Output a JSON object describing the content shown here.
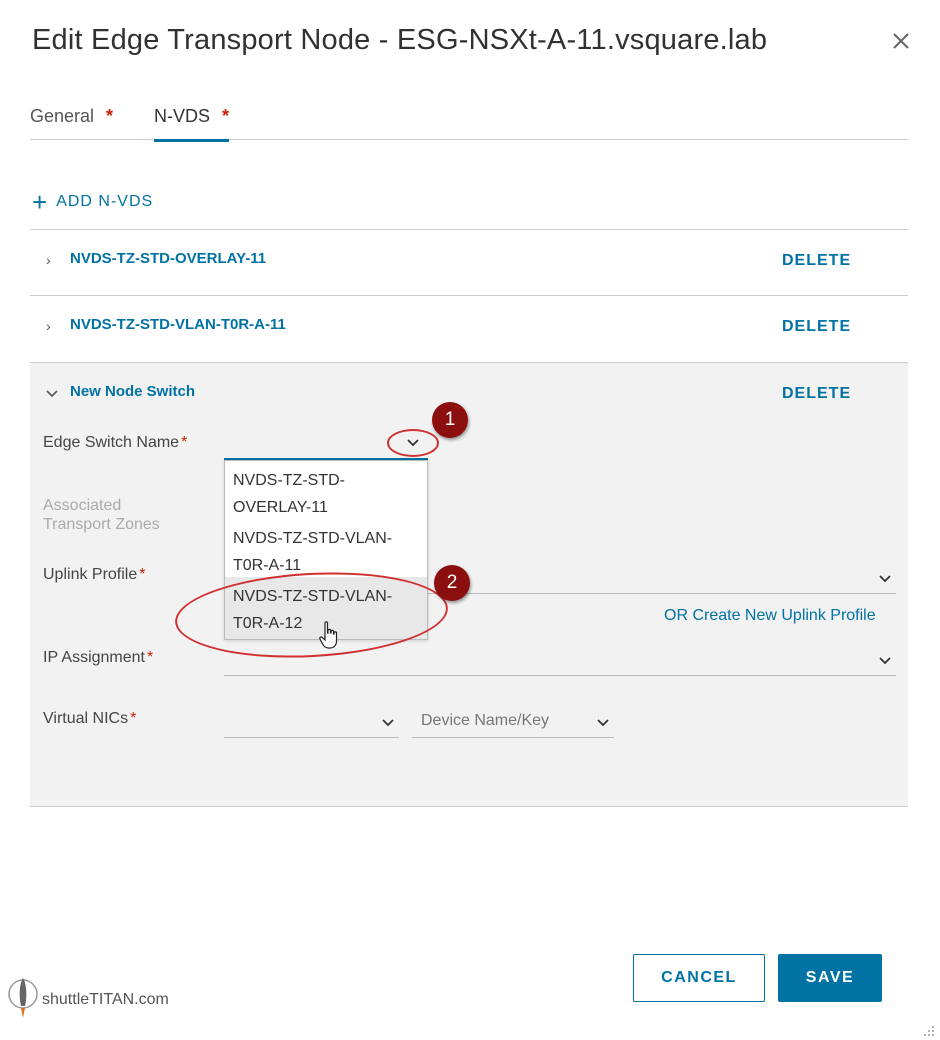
{
  "dialog": {
    "title": "Edit Edge Transport Node - ESG-NSXt-A-11.vsquare.lab",
    "close_icon": "close-icon"
  },
  "tabs": [
    {
      "label": "General",
      "required": "*"
    },
    {
      "label": "N-VDS",
      "required": "*",
      "active": true
    }
  ],
  "add_nvds": {
    "icon": "plus-icon",
    "label": "ADD N-VDS"
  },
  "switches": [
    {
      "name": "NVDS-TZ-STD-OVERLAY-11",
      "expanded": false,
      "delete_label": "DELETE"
    },
    {
      "name": "NVDS-TZ-STD-VLAN-T0R-A-11",
      "expanded": false,
      "delete_label": "DELETE"
    },
    {
      "name": "New Node Switch",
      "expanded": true,
      "delete_label": "DELETE"
    }
  ],
  "form": {
    "edge_switch_name": {
      "label": "Edge Switch Name",
      "required": "*"
    },
    "associated_tz": {
      "label_line1": "Associated",
      "label_line2": "Transport Zones"
    },
    "uplink_profile": {
      "label": "Uplink Profile",
      "required": "*",
      "create_link": "OR Create New Uplink Profile"
    },
    "ip_assignment": {
      "label": "IP Assignment",
      "required": "*"
    },
    "virtual_nics": {
      "label": "Virtual NICs",
      "required": "*",
      "device_placeholder": "Device Name/Key"
    }
  },
  "dropdown_options": [
    {
      "line1": "NVDS-TZ-STD-",
      "line2": "OVERLAY-11"
    },
    {
      "line1": "NVDS-TZ-STD-VLAN-",
      "line2": "T0R-A-11"
    },
    {
      "line1": "NVDS-TZ-STD-VLAN-",
      "line2": "T0R-A-12",
      "hovered": true
    }
  ],
  "annotations": [
    {
      "number": "1"
    },
    {
      "number": "2"
    }
  ],
  "footer": {
    "cancel_label": "CANCEL",
    "save_label": "SAVE"
  },
  "watermark": {
    "text": "shuttleTITAN.com"
  },
  "colors": {
    "accent": "#0072a3",
    "required": "#c92100",
    "callout": "#d03030",
    "badge": "#8b0f0f"
  }
}
